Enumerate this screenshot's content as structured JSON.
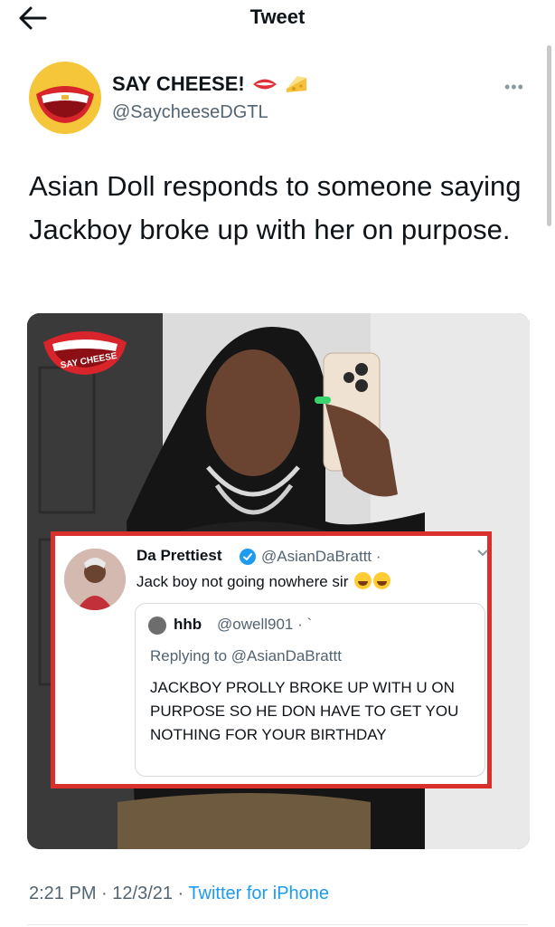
{
  "header": {
    "title": "Tweet",
    "back_icon": "arrow-left-icon"
  },
  "author": {
    "display_name": "SAY CHEESE!",
    "name_emojis": [
      "lips-emoji",
      "cheese-emoji"
    ],
    "handle": "@SaycheeseDGTL",
    "avatar": "say-cheese-logo",
    "more_icon": "more-horizontal-icon"
  },
  "tweet": {
    "text": "Asian Doll responds to someone saying Jackboy broke up with her on purpose."
  },
  "media": {
    "watermark": "say-cheese-logo",
    "watermark_text": "SAY CHEESE",
    "quoted": {
      "name": "Da Prettiest",
      "handle": "@AsianDaBrattt ·",
      "text": "Jack boy not going nowhere sir",
      "emojis": [
        "joy-emoji",
        "sweat-smile-emoji"
      ],
      "reply": {
        "name": "hhb",
        "handle": "@owell901 · `",
        "replying_prefix": "Replying to ",
        "replying_handle": "@AsianDaBrattt",
        "text": "JACKBOY PROLLY BROKE UP WITH U ON PURPOSE SO HE DON HAVE TO GET YOU NOTHING FOR YOUR BIRTHDAY"
      }
    }
  },
  "footer": {
    "time": "2:21 PM",
    "sep1": " · ",
    "date": "12/3/21",
    "sep2": " · ",
    "source": "Twitter for iPhone"
  },
  "colors": {
    "accent": "#1d9bf0",
    "highlight_border": "#d9302c",
    "logo_yellow": "#f5c53a"
  }
}
